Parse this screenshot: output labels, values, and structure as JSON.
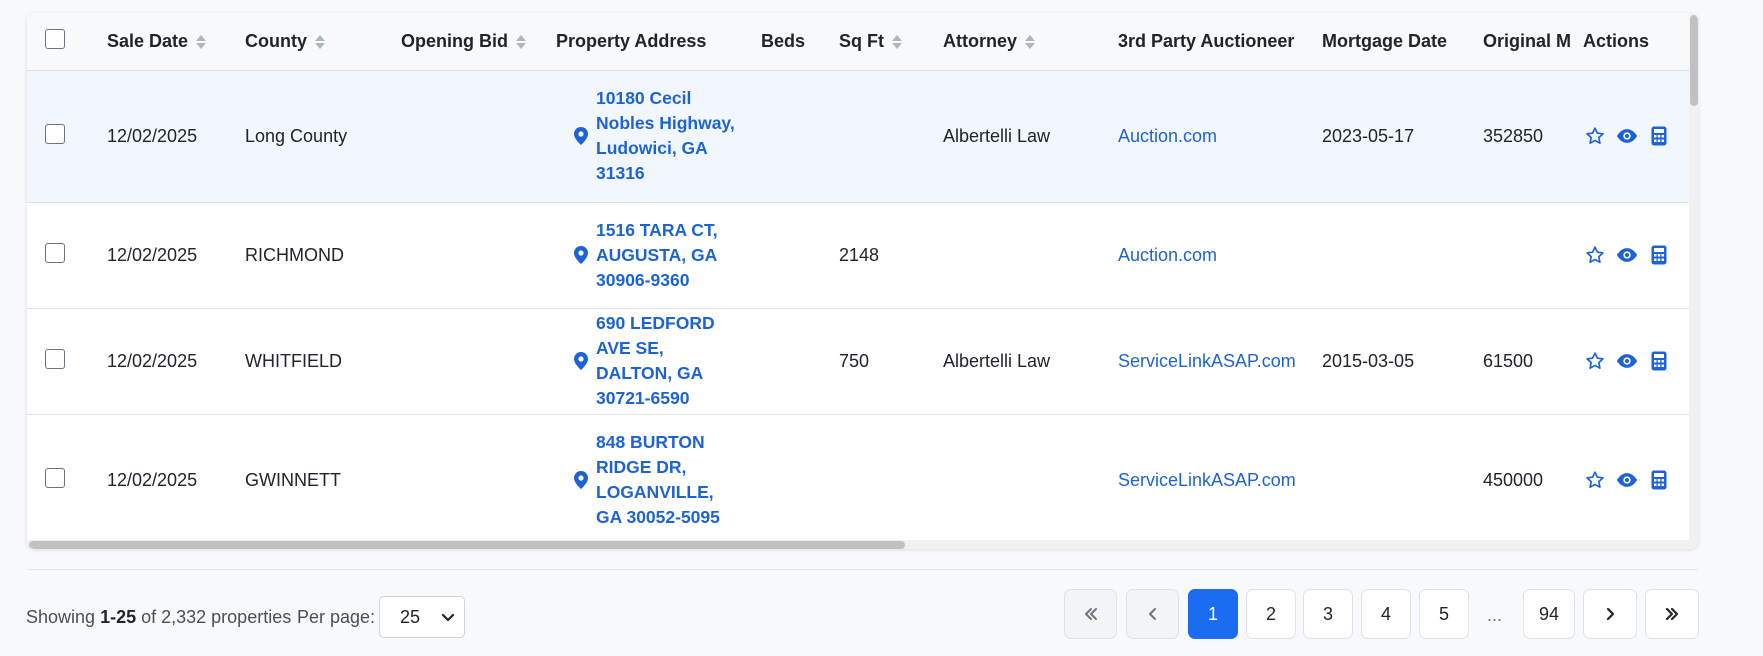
{
  "table": {
    "headers": {
      "sale_date": "Sale Date",
      "county": "County",
      "opening_bid": "Opening Bid",
      "property_address": "Property Address",
      "beds": "Beds",
      "sq_ft": "Sq Ft",
      "attorney": "Attorney",
      "auctioneer": "3rd Party Auctioneer",
      "mortgage_date": "Mortgage Date",
      "original": "Original M",
      "actions": "Actions"
    },
    "rows": [
      {
        "sale_date": "12/02/2025",
        "county": "Long County",
        "opening_bid": "",
        "address": "10180 Cecil Nobles Highway, Ludowici, GA 31316",
        "beds": "",
        "sq_ft": "",
        "attorney": "Albertelli Law",
        "auctioneer": "Auction.com",
        "mortgage_date": "2023-05-17",
        "original": "352850"
      },
      {
        "sale_date": "12/02/2025",
        "county": "RICHMOND",
        "opening_bid": "",
        "address": "1516 TARA CT, AUGUSTA, GA 30906-9360",
        "beds": "",
        "sq_ft": "2148",
        "attorney": "",
        "auctioneer": "Auction.com",
        "mortgage_date": "",
        "original": ""
      },
      {
        "sale_date": "12/02/2025",
        "county": "WHITFIELD",
        "opening_bid": "",
        "address": "690 LEDFORD AVE SE, DALTON, GA 30721-6590",
        "beds": "",
        "sq_ft": "750",
        "attorney": "Albertelli Law",
        "auctioneer": "ServiceLinkASAP.com",
        "mortgage_date": "2015-03-05",
        "original": "61500"
      },
      {
        "sale_date": "12/02/2025",
        "county": "GWINNETT",
        "opening_bid": "",
        "address": "848 BURTON RIDGE DR, LOGANVILLE, GA 30052-5095",
        "beds": "",
        "sq_ft": "",
        "attorney": "",
        "auctioneer": "ServiceLinkASAP.com",
        "mortgage_date": "",
        "original": "450000"
      }
    ]
  },
  "footer": {
    "showing_prefix": "Showing",
    "showing_range": "1-25",
    "showing_suffix": "of 2,332 properties",
    "per_page_label": "Per page:",
    "per_page_value": "25"
  },
  "pagination": {
    "pages": [
      "1",
      "2",
      "3",
      "4",
      "5"
    ],
    "ellipsis": "...",
    "last_page": "94",
    "active_page": "1"
  },
  "colors": {
    "link": "#1d63d6",
    "active_page": "#1a6df0",
    "highlight_row": "#f1f7fd"
  },
  "icons": {
    "sort": "sort-icon",
    "pin": "map-pin-icon",
    "star": "star-icon",
    "eye": "eye-icon",
    "calc": "calculator-icon",
    "first": "double-chevron-left-icon",
    "prev": "chevron-left-icon",
    "next": "chevron-right-icon",
    "last": "double-chevron-right-icon"
  }
}
